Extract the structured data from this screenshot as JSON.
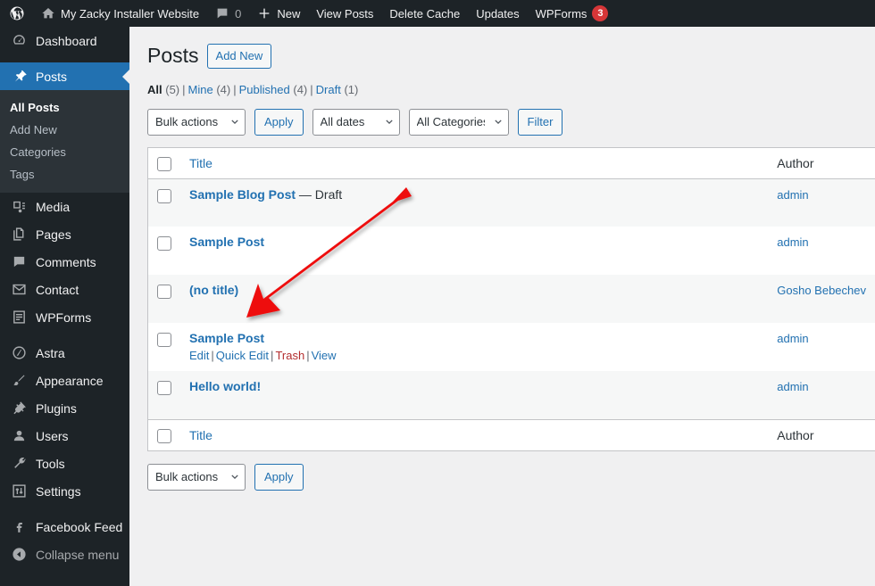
{
  "adminbar": {
    "logo_icon": "wordpress-logo-icon",
    "site_name": "My Zacky Installer Website",
    "site_icon": "home-icon",
    "comments_icon": "comment-bubble-icon",
    "comments_count": "0",
    "new_icon": "plus-icon",
    "new_label": "New",
    "view_posts_label": "View Posts",
    "delete_cache_label": "Delete Cache",
    "updates_label": "Updates",
    "wpforms_label": "WPForms",
    "wpforms_badge": "3"
  },
  "sidebar": {
    "items": [
      {
        "label": "Dashboard",
        "icon": "dashboard-icon",
        "name": "dashboard"
      },
      {
        "label": "Posts",
        "icon": "pin-icon",
        "name": "posts"
      },
      {
        "label": "Media",
        "icon": "media-icon",
        "name": "media"
      },
      {
        "label": "Pages",
        "icon": "pages-icon",
        "name": "pages"
      },
      {
        "label": "Comments",
        "icon": "comment-bubble-icon",
        "name": "comments"
      },
      {
        "label": "Contact",
        "icon": "envelope-icon",
        "name": "contact"
      },
      {
        "label": "WPForms",
        "icon": "wpforms-icon",
        "name": "wpforms"
      },
      {
        "label": "Astra",
        "icon": "astra-icon",
        "name": "astra"
      },
      {
        "label": "Appearance",
        "icon": "paintbrush-icon",
        "name": "appearance"
      },
      {
        "label": "Plugins",
        "icon": "plug-icon",
        "name": "plugins"
      },
      {
        "label": "Users",
        "icon": "user-icon",
        "name": "users"
      },
      {
        "label": "Tools",
        "icon": "wrench-icon",
        "name": "tools"
      },
      {
        "label": "Settings",
        "icon": "settings-sliders-icon",
        "name": "settings"
      },
      {
        "label": "Facebook Feed",
        "icon": "facebook-icon",
        "name": "facebook-feed"
      }
    ],
    "submenu": [
      {
        "label": "All Posts",
        "current": true
      },
      {
        "label": "Add New",
        "current": false
      },
      {
        "label": "Categories",
        "current": false
      },
      {
        "label": "Tags",
        "current": false
      }
    ],
    "collapse_label": "Collapse menu",
    "collapse_icon": "collapse-arrow-icon",
    "accent_color": "#2271b1"
  },
  "page": {
    "title": "Posts",
    "add_new_label": "Add New"
  },
  "filters": [
    {
      "label": "All",
      "count": "(5)",
      "current": true
    },
    {
      "label": "Mine",
      "count": "(4)",
      "current": false
    },
    {
      "label": "Published",
      "count": "(4)",
      "current": false
    },
    {
      "label": "Draft",
      "count": "(1)",
      "current": false
    }
  ],
  "tablenav_top": {
    "bulk_actions_value": "Bulk actions",
    "apply_label": "Apply",
    "dates_value": "All dates",
    "categories_value": "All Categories",
    "filter_label": "Filter"
  },
  "tablenav_bottom": {
    "bulk_actions_value": "Bulk actions",
    "apply_label": "Apply"
  },
  "table": {
    "columns": {
      "title": "Title",
      "author": "Author"
    },
    "rows": [
      {
        "title": "Sample Blog Post",
        "state": "— Draft",
        "author": "admin",
        "actions": null
      },
      {
        "title": "Sample Post",
        "state": "",
        "author": "admin",
        "actions": null
      },
      {
        "title": "(no title)",
        "state": "",
        "author": "Gosho Bebechev",
        "actions": null
      },
      {
        "title": "Sample Post",
        "state": "",
        "author": "admin",
        "actions": {
          "edit": "Edit",
          "quick_edit": "Quick Edit",
          "trash": "Trash",
          "view": "View"
        }
      },
      {
        "title": "Hello world!",
        "state": "",
        "author": "admin",
        "actions": null
      }
    ]
  },
  "annotation": {
    "arrow_color": "#ee1111",
    "name": "red-pointer-arrow"
  }
}
